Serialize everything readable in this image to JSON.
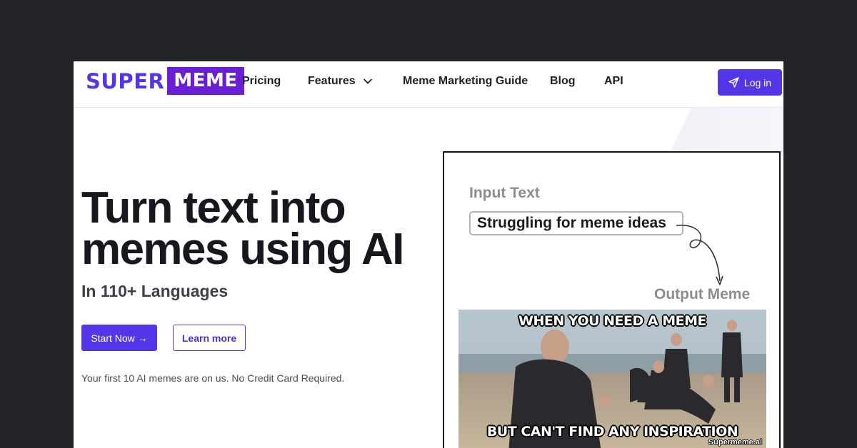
{
  "brand": {
    "part1": "SUPER",
    "part2": "MEME"
  },
  "nav": {
    "items": [
      "Pricing",
      "Features",
      "Meme Marketing Guide",
      "Blog",
      "API"
    ],
    "login_label": "Log in"
  },
  "hero": {
    "headline_line1": "Turn text into",
    "headline_line2": "memes using AI",
    "subheadline": "In 110+ Languages",
    "start_label": "Start Now →",
    "learn_label": "Learn more",
    "note": "Your first 10 AI memes are on us. No Credit Card Required."
  },
  "demo": {
    "input_label": "Input Text",
    "input_text": "Struggling for meme ideas",
    "output_label": "Output Meme",
    "meme_top": "WHEN YOU NEED A MEME",
    "meme_bottom": "BUT CAN'T FIND ANY INSPIRATION",
    "watermark": "Supermeme.ai"
  },
  "colors": {
    "accent": "#5236e8",
    "logo_block": "#6a1fd6",
    "page_background": "#222227"
  },
  "icons": {
    "features_dropdown": "chevron-down-icon",
    "login": "paper-plane-icon"
  }
}
